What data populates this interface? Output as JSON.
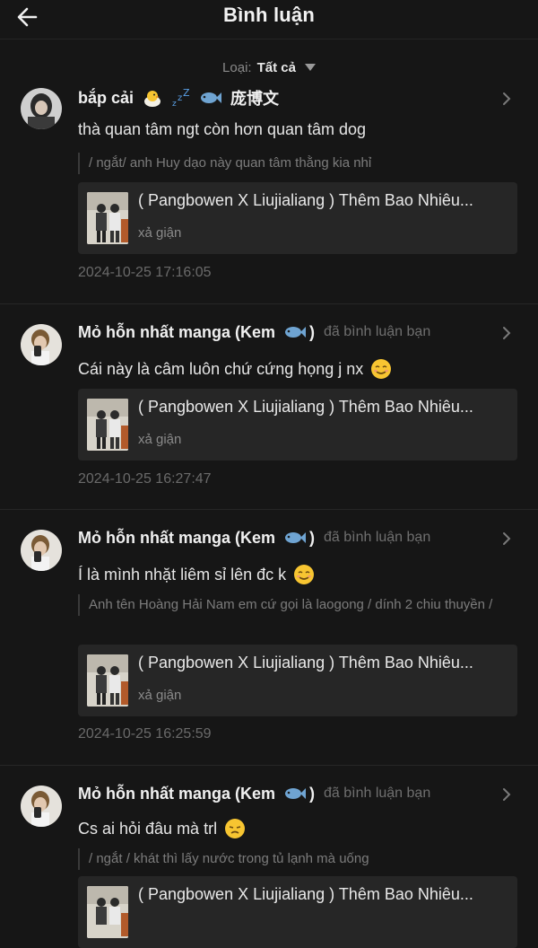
{
  "header": {
    "title": "Bình luận"
  },
  "filter": {
    "label": "Loại:",
    "value": "Tất cả"
  },
  "items": [
    {
      "username": "bắp cải",
      "name_extra": "庞博文",
      "action": "",
      "comment": "thà quan tâm ngt còn hơn quan tâm dog",
      "quote": "/ ngắt/ anh Huy dạo này quan tâm thằng kia nhỉ",
      "card_title": "( Pangbowen X Liujialiang ) Thêm Bao Nhiêu...",
      "card_sub": "xả giận",
      "time": "2024-10-25 17:16:05"
    },
    {
      "username": "Mỏ hỗn nhất manga (Kem",
      "name_extra": ")",
      "action": "đã bình luận bạn",
      "comment": "Cái này là câm luôn chứ cứng họng j nx",
      "quote": "",
      "card_title": "( Pangbowen X Liujialiang ) Thêm Bao Nhiêu...",
      "card_sub": "xả giận",
      "time": "2024-10-25 16:27:47"
    },
    {
      "username": "Mỏ hỗn nhất manga (Kem",
      "name_extra": ")",
      "action": "đã bình luận bạn",
      "comment": "Í là mình nhặt liêm sỉ lên đc k",
      "quote": "Anh tên Hoàng Hải Nam em cứ gọi là laogong / dính 2 chiu thuyền /",
      "card_title": "( Pangbowen X Liujialiang ) Thêm Bao Nhiêu...",
      "card_sub": "xả giận",
      "time": "2024-10-25 16:25:59"
    },
    {
      "username": "Mỏ hỗn nhất manga (Kem",
      "name_extra": ")",
      "action": "đã bình luận bạn",
      "comment": "Cs ai hỏi đâu mà trl",
      "quote": "/ ngắt / khát thì lấy nước trong tủ lạnh mà uống",
      "card_title": "( Pangbowen X Liujialiang ) Thêm Bao Nhiêu...",
      "card_sub": "",
      "time": ""
    }
  ],
  "icons": {
    "back": "arrow-left-icon",
    "chevron": "chevron-right-icon",
    "filter_caret": "caret-down-icon",
    "emoji_chick": "hatching-chick-emoji",
    "emoji_zzz": "zzz-emoji",
    "emoji_fish": "fish-emoji",
    "emoji_smile": "smiling-face-emoji",
    "emoji_sad": "disappointed-face-emoji"
  },
  "colors": {
    "background": "#161616",
    "card": "#262626",
    "text": "#e9e9e9",
    "muted": "#6f6f6f",
    "emoji_yellow": "#f7c531",
    "fish_blue": "#6fa4d2"
  }
}
